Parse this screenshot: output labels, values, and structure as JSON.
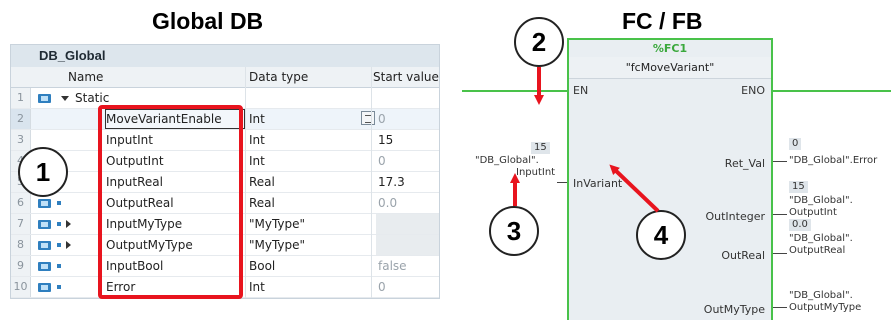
{
  "headings": {
    "left": "Global DB",
    "right": "FC / FB"
  },
  "db": {
    "title": "DB_Global",
    "columns": [
      "Name",
      "Data type",
      "Start value"
    ],
    "static_label": "Static",
    "rows": [
      {
        "num": "1"
      },
      {
        "num": "2",
        "name": "MoveVariantEnable",
        "type": "Int",
        "value": "0"
      },
      {
        "num": "3",
        "name": "InputInt",
        "type": "Int",
        "value": "15"
      },
      {
        "num": "4",
        "name": "OutputInt",
        "type": "Int",
        "value": "0"
      },
      {
        "num": "5",
        "name": "InputReal",
        "type": "Real",
        "value": "17.3"
      },
      {
        "num": "6",
        "name": "OutputReal",
        "type": "Real",
        "value": "0.0"
      },
      {
        "num": "7",
        "name": "InputMyType",
        "type": "\"MyType\"",
        "value": ""
      },
      {
        "num": "8",
        "name": "OutputMyType",
        "type": "\"MyType\"",
        "value": ""
      },
      {
        "num": "9",
        "name": "InputBool",
        "type": "Bool",
        "value": "false"
      },
      {
        "num": "10",
        "name": "Error",
        "type": "Int",
        "value": "0"
      }
    ]
  },
  "callouts": [
    "1",
    "2",
    "3",
    "4"
  ],
  "fb": {
    "type_label": "%FC1",
    "name": "\"fcMoveVariant\"",
    "en": "EN",
    "eno": "ENO",
    "in_pin": "InVariant",
    "in_value": "15",
    "in_tag_1": "\"DB_Global\".",
    "in_tag_2": "InputInt",
    "outputs": [
      {
        "pin": "Ret_Val",
        "value": "0",
        "tag_1": "\"DB_Global\".Error",
        "tag_2": ""
      },
      {
        "pin": "OutInteger",
        "value": "15",
        "tag_1": "\"DB_Global\".",
        "tag_2": "OutputInt"
      },
      {
        "pin": "OutReal",
        "value": "0.0",
        "tag_1": "\"DB_Global\".",
        "tag_2": "OutputReal"
      },
      {
        "pin": "OutMyType",
        "value": "",
        "tag_1": "\"DB_Global\".",
        "tag_2": "OutputMyType"
      }
    ]
  },
  "colors": {
    "callout_red": "#e8141e",
    "power_rail_green": "#49c24a",
    "db_icon_blue": "#2f7fbf"
  }
}
